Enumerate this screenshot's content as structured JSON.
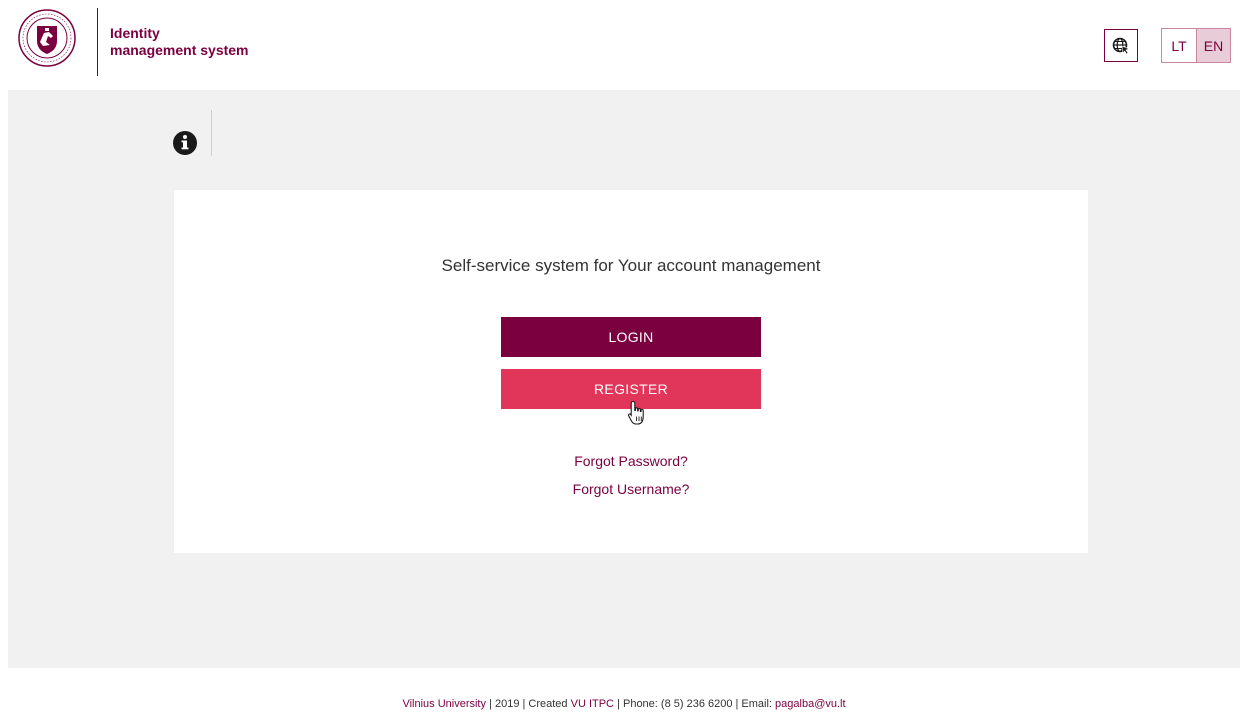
{
  "header": {
    "title_line1": "Identity",
    "title_line2": "management system",
    "logo_icon": "vilnius-university-seal-icon",
    "accessibility_icon": "globe-cursor-icon",
    "languages": [
      {
        "code": "LT",
        "active": false
      },
      {
        "code": "EN",
        "active": true
      }
    ]
  },
  "info_icon": "info-circle-icon",
  "card": {
    "heading": "Self-service system for Your account management",
    "login_label": "LOGIN",
    "register_label": "REGISTER",
    "forgot_password": "Forgot Password?",
    "forgot_username": "Forgot Username?"
  },
  "footer": {
    "university": "Vilnius University",
    "sep1": " | 2019 | Created ",
    "itpc": "VU ITPC",
    "sep2": " | Phone: (8 5) 236 6200 | Email: ",
    "email": "pagalba@vu.lt"
  },
  "colors": {
    "brand": "#7b0040",
    "accent": "#e1355a",
    "background": "#f1f1f1"
  }
}
